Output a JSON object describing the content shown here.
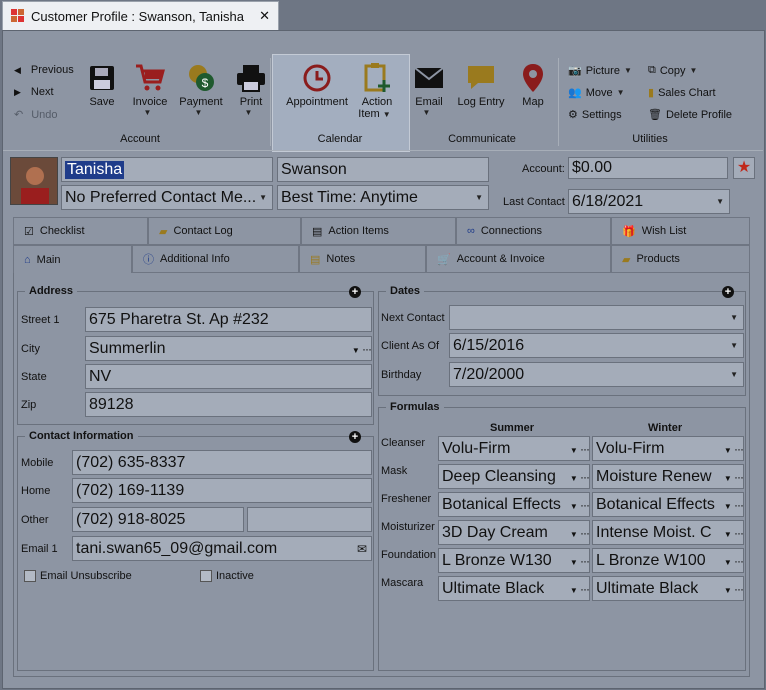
{
  "window": {
    "title": "Customer Profile : Swanson, Tanisha",
    "close": "✕"
  },
  "ribbon": {
    "account": {
      "label": "Account",
      "previous": "Previous",
      "next": "Next",
      "undo": "Undo",
      "save": "Save",
      "invoice": "Invoice",
      "payment": "Payment",
      "print": "Print"
    },
    "calendar": {
      "label": "Calendar",
      "appointment": "Appointment",
      "action_item_1": "Action",
      "action_item_2": "Item"
    },
    "communicate": {
      "label": "Communicate",
      "email": "Email",
      "log_entry": "Log Entry",
      "map": "Map"
    },
    "utilities": {
      "label": "Utilities",
      "picture": "Picture",
      "move": "Move",
      "settings": "Settings",
      "copy": "Copy",
      "sales_chart": "Sales Chart",
      "delete_profile": "Delete Profile"
    }
  },
  "profile": {
    "first_name": "Tanisha",
    "last_name": "Swanson",
    "preferred_contact": "No Preferred Contact Me...",
    "best_time": "Best Time: Anytime",
    "account_label": "Account:",
    "account_value": "$0.00",
    "last_contact_label": "Last Contact",
    "last_contact": "6/18/2021"
  },
  "tabs_top": [
    "Checklist",
    "Contact Log",
    "Action Items",
    "Connections",
    "Wish List"
  ],
  "tabs_bottom": [
    "Main",
    "Additional Info",
    "Notes",
    "Account & Invoice",
    "Products"
  ],
  "address": {
    "title": "Address",
    "street_label": "Street 1",
    "street": "675 Pharetra St. Ap #232",
    "city_label": "City",
    "city": "Summerlin",
    "state_label": "State",
    "state": "NV",
    "zip_label": "Zip",
    "zip": "89128"
  },
  "contact": {
    "title": "Contact Information",
    "mobile_label": "Mobile",
    "mobile": "(702) 635-8337",
    "home_label": "Home",
    "home": "(702) 169-1139",
    "other_label": "Other",
    "other": "(702) 918-8025",
    "other2": "",
    "email_label": "Email 1",
    "email": "tani.swan65_09@gmail.com",
    "unsubscribe": "Email Unsubscribe",
    "inactive": "Inactive"
  },
  "dates": {
    "title": "Dates",
    "next_contact_label": "Next Contact",
    "next_contact": "",
    "client_as_of_label": "Client As Of",
    "client_as_of": "6/15/2016",
    "birthday_label": "Birthday",
    "birthday": "7/20/2000"
  },
  "formulas": {
    "title": "Formulas",
    "summer": "Summer",
    "winter": "Winter",
    "rows": [
      {
        "label": "Cleanser",
        "summer": "Volu-Firm",
        "winter": "Volu-Firm"
      },
      {
        "label": "Mask",
        "summer": "Deep Cleansing",
        "winter": "Moisture Renew"
      },
      {
        "label": "Freshener",
        "summer": "Botanical Effects",
        "winter": "Botanical Effects"
      },
      {
        "label": "Moisturizer",
        "summer": "3D Day Cream",
        "winter": "Intense Moist. C"
      },
      {
        "label": "Foundation",
        "summer": "L Bronze W130",
        "winter": "L Bronze W100"
      },
      {
        "label": "Mascara",
        "summer": "Ultimate Black",
        "winter": "Ultimate Black"
      }
    ]
  },
  "colors": {
    "accent_star": "#c0281a",
    "highlight": "#1f3c8a"
  }
}
